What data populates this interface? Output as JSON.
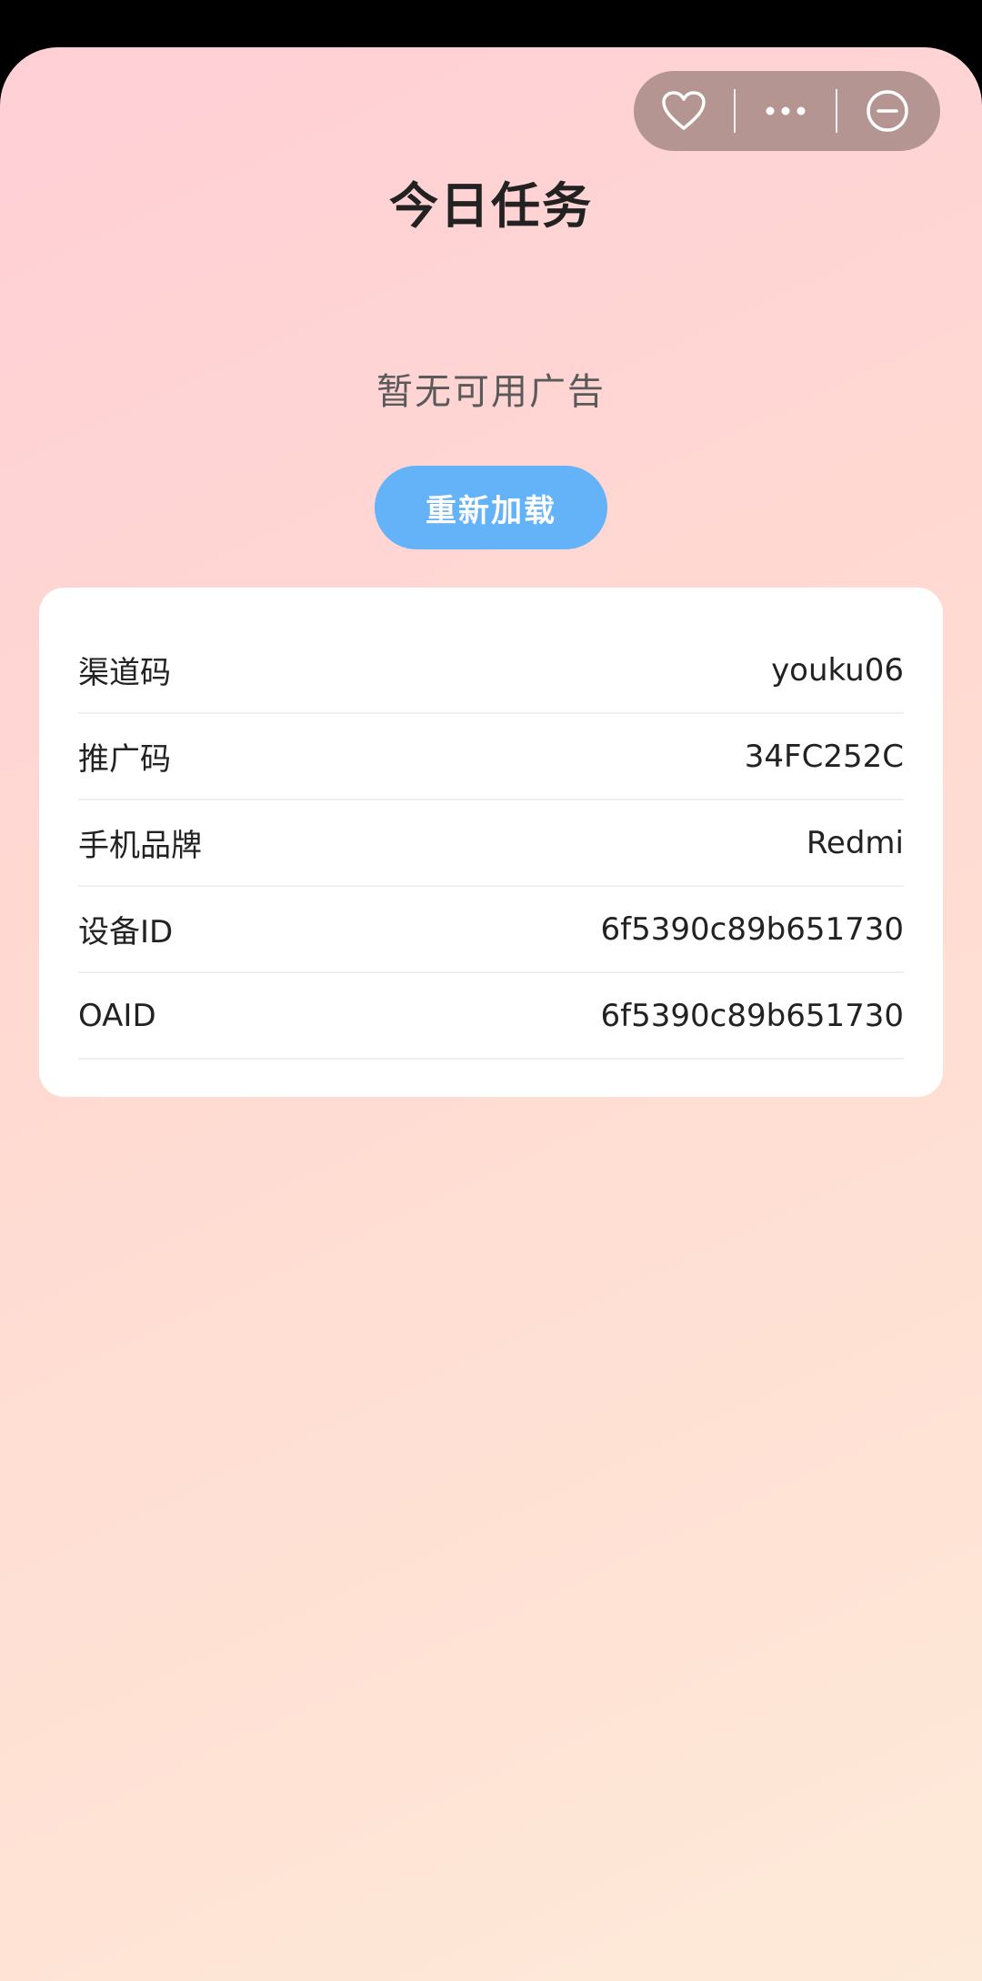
{
  "page": {
    "title": "今日任务",
    "empty_message": "暂无可用广告",
    "reload_label": "重新加载"
  },
  "capsule": {
    "icons": [
      "heart-icon",
      "more-icon",
      "minimize-icon"
    ]
  },
  "info": {
    "rows": [
      {
        "label": "渠道码",
        "value": "youku06"
      },
      {
        "label": "推广码",
        "value": "34FC252C"
      },
      {
        "label": "手机品牌",
        "value": "Redmi"
      },
      {
        "label": "设备ID",
        "value": "6f5390c89b651730"
      },
      {
        "label": "OAID",
        "value": "6f5390c89b651730"
      }
    ]
  },
  "colors": {
    "button": "#64b3f8",
    "capsule": "#b59592"
  }
}
